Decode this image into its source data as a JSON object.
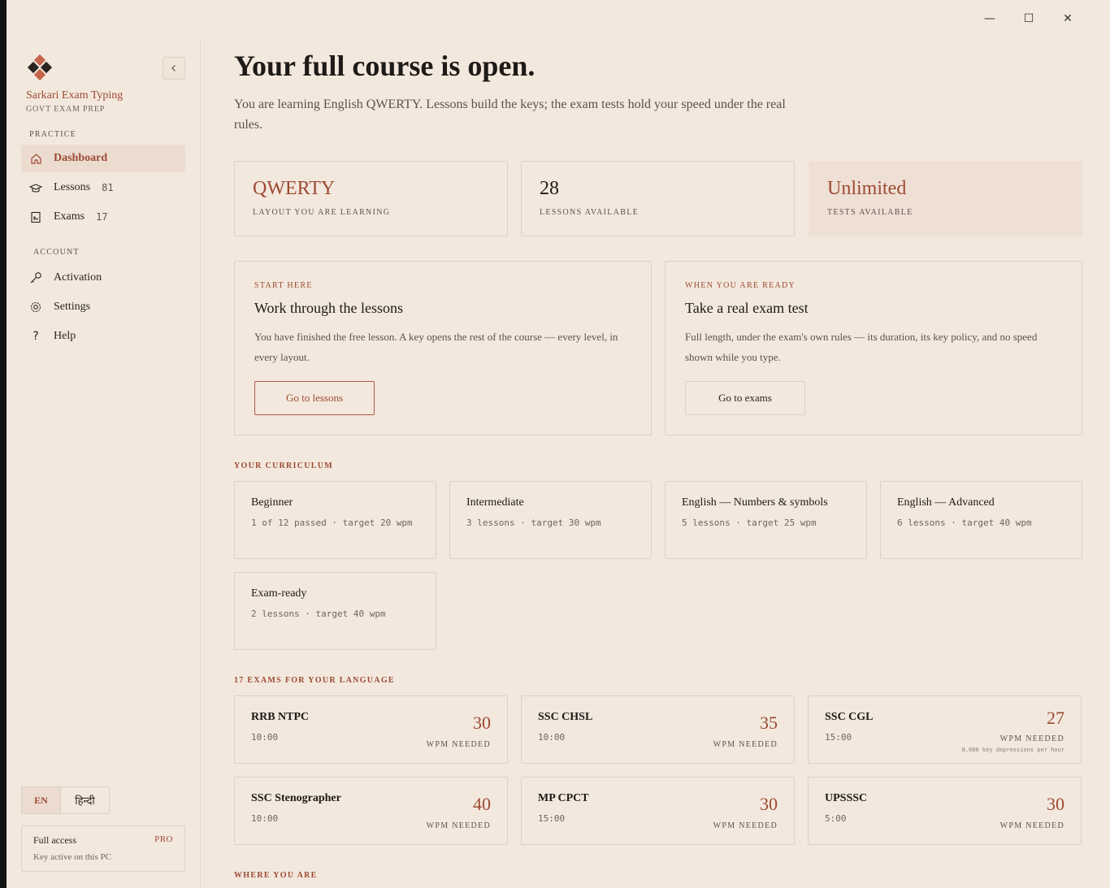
{
  "window": {
    "minimize": "—",
    "maximize": "☐",
    "close": "✕"
  },
  "sidebar": {
    "brand": "Sarkari Exam Typing",
    "brand_sub": "GOVT EXAM PREP",
    "practice_label": "PRACTICE",
    "account_label": "ACCOUNT",
    "practice_items": [
      {
        "label": "Dashboard",
        "icon": "home-icon",
        "count": ""
      },
      {
        "label": "Lessons",
        "icon": "graduation-cap-icon",
        "count": "81"
      },
      {
        "label": "Exams",
        "icon": "document-icon",
        "count": "17"
      }
    ],
    "account_items": [
      {
        "label": "Activation",
        "icon": "key-icon"
      },
      {
        "label": "Settings",
        "icon": "gear-icon"
      },
      {
        "label": "Help",
        "icon": "question-icon"
      }
    ],
    "lang_en": "EN",
    "lang_hi": "हिन्दी",
    "license_title": "Full access",
    "license_sub": "Key active on this PC",
    "license_badge": "PRO"
  },
  "main": {
    "title": "Your full course is open.",
    "subtitle": "You are learning English QWERTY. Lessons build the keys; the exam tests hold your speed under the real rules.",
    "stats": [
      {
        "value": "QWERTY",
        "label": "LAYOUT YOU ARE LEARNING"
      },
      {
        "value": "28",
        "label": "LESSONS AVAILABLE"
      },
      {
        "value": "Unlimited",
        "label": "TESTS AVAILABLE"
      }
    ],
    "cta_lessons": {
      "kicker": "START HERE",
      "heading": "Work through the lessons",
      "desc": "You have finished the free lesson. A key opens the rest of the course — every level, in every layout.",
      "button": "Go to lessons"
    },
    "cta_exams": {
      "kicker": "WHEN YOU ARE READY",
      "heading": "Take a real exam test",
      "desc": "Full length, under the exam's own rules — its duration, its key policy, and no speed shown while you type.",
      "button": "Go to exams"
    },
    "curriculum_label": "YOUR CURRICULUM",
    "levels": [
      {
        "name": "Beginner",
        "meta": "1 of 12 passed · target 20 wpm"
      },
      {
        "name": "Intermediate",
        "meta": "3 lessons · target 30 wpm"
      },
      {
        "name": "English — Numbers & symbols",
        "meta": "5 lessons · target 25 wpm"
      },
      {
        "name": "English — Advanced",
        "meta": "6 lessons · target 40 wpm"
      },
      {
        "name": "Exam-ready",
        "meta": "2 lessons · target 40 wpm"
      }
    ],
    "exams_label": "17 EXAMS FOR YOUR LANGUAGE",
    "wpm_label": "WPM NEEDED",
    "exams": [
      {
        "name": "RRB NTPC",
        "time": "10:00",
        "wpm": "30",
        "note": ""
      },
      {
        "name": "SSC CHSL",
        "time": "10:00",
        "wpm": "35",
        "note": ""
      },
      {
        "name": "SSC CGL",
        "time": "15:00",
        "wpm": "27",
        "note": "8,000 key depressions per hour"
      },
      {
        "name": "SSC Stenographer",
        "time": "10:00",
        "wpm": "40",
        "note": ""
      },
      {
        "name": "MP CPCT",
        "time": "15:00",
        "wpm": "30",
        "note": ""
      },
      {
        "name": "UPSSSC",
        "time": "5:00",
        "wpm": "30",
        "note": ""
      }
    ],
    "where_label": "WHERE YOU ARE"
  }
}
